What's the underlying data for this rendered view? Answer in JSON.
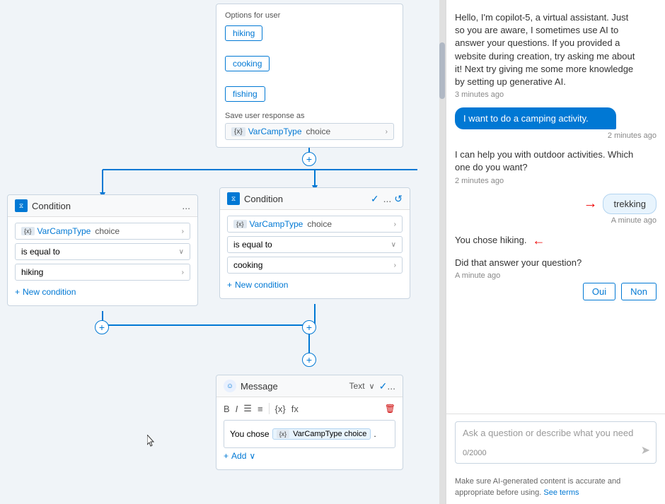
{
  "canvas": {
    "options_card": {
      "title": "Options for user",
      "options": [
        "hiking",
        "cooking",
        "fishing"
      ],
      "save_label": "Save user response as",
      "var_badge": "{x}",
      "var_name": "VarCampType",
      "var_type": "choice"
    },
    "condition_left": {
      "title": "Condition",
      "dots": "...",
      "var_badge": "{x}",
      "var_name": "VarCampType",
      "var_type": "choice",
      "operator": "is equal to",
      "value": "hiking",
      "add_label": "New condition"
    },
    "condition_right": {
      "title": "Condition",
      "dots": "...",
      "var_badge": "{x}",
      "var_name": "VarCampType",
      "var_type": "choice",
      "operator": "is equal to",
      "value": "cooking",
      "add_label": "New condition"
    },
    "message_card": {
      "title": "Message",
      "type": "Text",
      "dots": "...",
      "prefix_text": "You chose",
      "var_badge": "{x}",
      "var_name": "VarCampType",
      "var_type": "choice",
      "suffix": ".",
      "add_label": "Add",
      "toolbar": {
        "bold": "B",
        "italic": "I",
        "bullet": "≡",
        "numbered": "≡",
        "var": "{x}",
        "formula": "fx"
      }
    }
  },
  "chat": {
    "bot_msg1": "Hello, I'm copilot-5, a virtual assistant. Just so you are aware, I sometimes use AI to answer your questions. If you provided a website during creation, try asking me about it! Next try giving me some more knowledge by setting up generative AI.",
    "bot_msg1_time": "3 minutes ago",
    "user_msg1": "I want to do a camping activity.",
    "user_msg1_time": "2 minutes ago",
    "bot_msg2": "I can help you with outdoor activities. Which one do you want?",
    "bot_msg2_time": "2 minutes ago",
    "trekking_label": "trekking",
    "trekking_time": "A minute ago",
    "bot_msg3": "You chose hiking.",
    "bot_msg4": "Did that answer your question?",
    "bot_msg4_time": "A minute ago",
    "yes_label": "Oui",
    "no_label": "Non",
    "input_placeholder": "Ask a question or describe what you need",
    "char_count": "0/2000",
    "disclaimer": "Make sure AI-generated content is accurate and appropriate before using.",
    "see_terms": "See terms"
  }
}
